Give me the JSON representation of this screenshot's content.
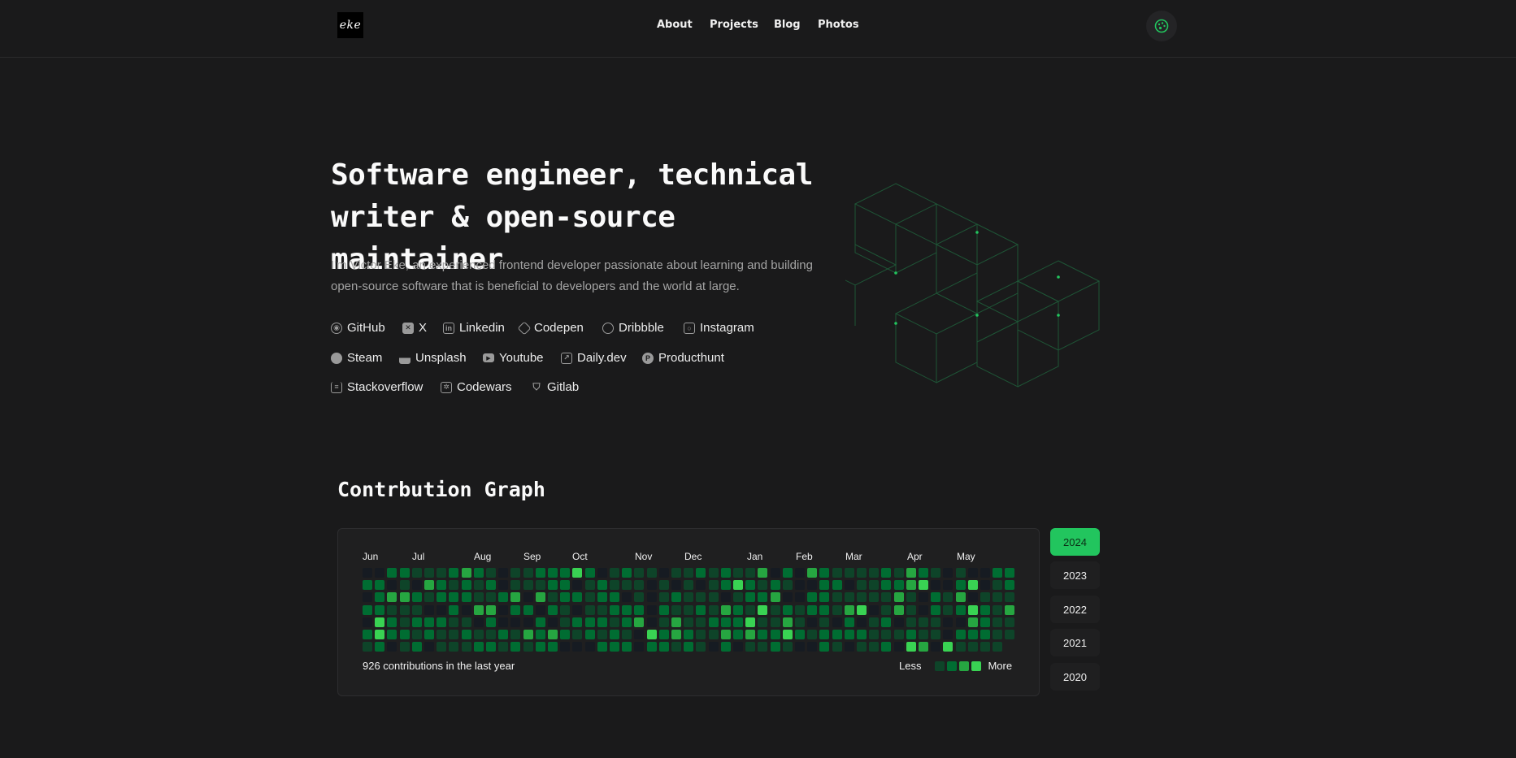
{
  "header": {
    "logo_text": "eke",
    "nav": [
      "About",
      "Projects",
      "Blog",
      "Photos"
    ]
  },
  "hero": {
    "title_line1": "Software engineer, technical",
    "title_line2": "writer & open-source maintainer",
    "description": "I'm Victor Eke, an experienced frontend developer passionate about learning and building open-source software that is beneficial to developers and the world at large."
  },
  "socials": [
    {
      "label": "GitHub",
      "icon": "github-icon"
    },
    {
      "label": "X",
      "icon": "x-icon"
    },
    {
      "label": "Linkedin",
      "icon": "linkedin-icon"
    },
    {
      "label": "Codepen",
      "icon": "codepen-icon"
    },
    {
      "label": "Dribbble",
      "icon": "dribbble-icon"
    },
    {
      "label": "Instagram",
      "icon": "instagram-icon"
    },
    {
      "label": "Steam",
      "icon": "steam-icon"
    },
    {
      "label": "Unsplash",
      "icon": "unsplash-icon"
    },
    {
      "label": "Youtube",
      "icon": "youtube-icon"
    },
    {
      "label": "Daily.dev",
      "icon": "external-link-icon"
    },
    {
      "label": "Producthunt",
      "icon": "producthunt-icon"
    },
    {
      "label": "Stackoverflow",
      "icon": "stackoverflow-icon"
    },
    {
      "label": "Codewars",
      "icon": "codewars-icon"
    },
    {
      "label": "Gitlab",
      "icon": "gitlab-icon"
    }
  ],
  "contributions": {
    "title": "Contrbution Graph",
    "months": [
      "Jun",
      "Jul",
      "Aug",
      "Sep",
      "Oct",
      "Nov",
      "Dec",
      "Jan",
      "Feb",
      "Mar",
      "Apr",
      "May"
    ],
    "summary": "926 contributions in the last year",
    "legend_less": "Less",
    "legend_more": "More",
    "colors": [
      "#161b22",
      "#0e4429",
      "#006d32",
      "#26a641",
      "#39d353"
    ],
    "years": [
      "2024",
      "2023",
      "2022",
      "2021",
      "2020"
    ],
    "active_year": "2024"
  }
}
